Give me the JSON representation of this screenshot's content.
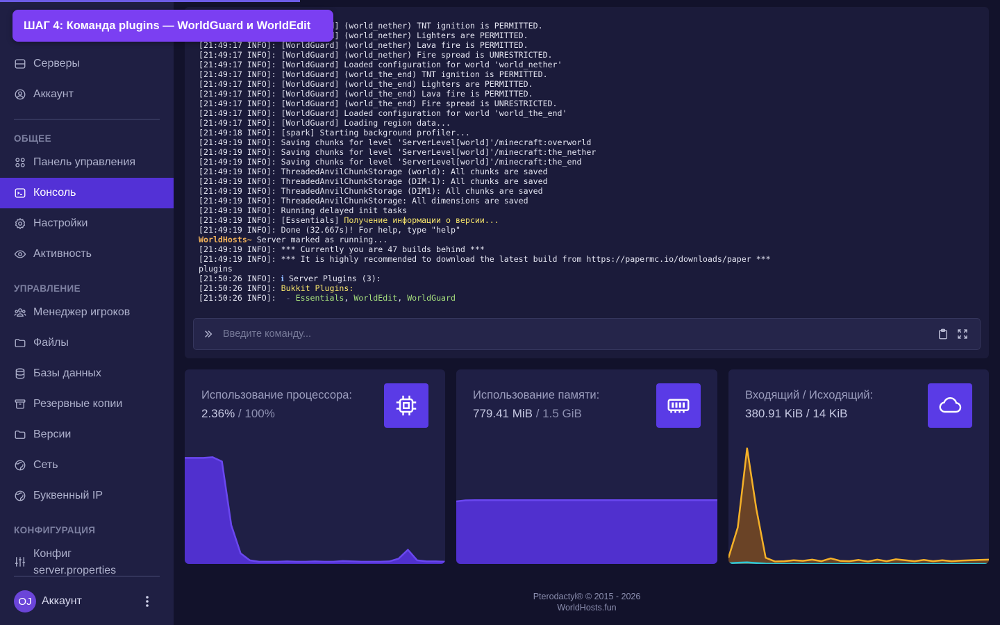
{
  "banner": {
    "text": "ШАГ 4: Команда plugins — WorldGuard и WorldEdit"
  },
  "sidebar": {
    "items_top": [
      {
        "label": "Серверы",
        "icon": "server-icon"
      },
      {
        "label": "Аккаунт",
        "icon": "user-circle-icon"
      }
    ],
    "section_general": "ОБЩЕЕ",
    "items_general": [
      {
        "label": "Панель управления",
        "icon": "dashboard-icon"
      },
      {
        "label": "Консоль",
        "icon": "terminal-icon",
        "active": true
      },
      {
        "label": "Настройки",
        "icon": "gear-icon"
      },
      {
        "label": "Активность",
        "icon": "eye-icon"
      }
    ],
    "section_manage": "УПРАВЛЕНИЕ",
    "items_manage": [
      {
        "label": "Менеджер игроков",
        "icon": "users-icon"
      },
      {
        "label": "Файлы",
        "icon": "folder-icon"
      },
      {
        "label": "Базы данных",
        "icon": "database-icon"
      },
      {
        "label": "Резервные копии",
        "icon": "archive-icon"
      },
      {
        "label": "Версии",
        "icon": "folder-icon"
      },
      {
        "label": "Сеть",
        "icon": "globe-icon"
      },
      {
        "label": "Буквенный IP",
        "icon": "globe-icon"
      }
    ],
    "section_config": "КОНФИГУРАЦИЯ",
    "config_item": {
      "line1": "Конфиг",
      "line2": "server.properties",
      "icon": "sliders-icon"
    },
    "user": {
      "initials": "OJ",
      "label": "Аккаунт"
    }
  },
  "console": {
    "lines": [
      [
        {
          "t": "[21:49:17 INFO]: [WorldGuard] (world_nether) TNT ignition is PERMITTED."
        }
      ],
      [
        {
          "t": "[21:49:17 INFO]: [WorldGuard] (world_nether) Lighters are PERMITTED."
        }
      ],
      [
        {
          "t": "[21:49:17 INFO]: [WorldGuard] (world_nether) Lava fire is PERMITTED."
        }
      ],
      [
        {
          "t": "[21:49:17 INFO]: [WorldGuard] (world_nether) Fire spread is UNRESTRICTED."
        }
      ],
      [
        {
          "t": "[21:49:17 INFO]: [WorldGuard] Loaded configuration for world 'world_nether'"
        }
      ],
      [
        {
          "t": "[21:49:17 INFO]: [WorldGuard] (world_the_end) TNT ignition is PERMITTED."
        }
      ],
      [
        {
          "t": "[21:49:17 INFO]: [WorldGuard] (world_the_end) Lighters are PERMITTED."
        }
      ],
      [
        {
          "t": "[21:49:17 INFO]: [WorldGuard] (world_the_end) Lava fire is PERMITTED."
        }
      ],
      [
        {
          "t": "[21:49:17 INFO]: [WorldGuard] (world_the_end) Fire spread is UNRESTRICTED."
        }
      ],
      [
        {
          "t": "[21:49:17 INFO]: [WorldGuard] Loaded configuration for world 'world_the_end'"
        }
      ],
      [
        {
          "t": "[21:49:17 INFO]: [WorldGuard] Loading region data..."
        }
      ],
      [
        {
          "t": "[21:49:18 INFO]: [spark] Starting background profiler..."
        }
      ],
      [
        {
          "t": "[21:49:19 INFO]: Saving chunks for level 'ServerLevel[world]'/minecraft:overworld"
        }
      ],
      [
        {
          "t": "[21:49:19 INFO]: Saving chunks for level 'ServerLevel[world]'/minecraft:the_nether"
        }
      ],
      [
        {
          "t": "[21:49:19 INFO]: Saving chunks for level 'ServerLevel[world]'/minecraft:the_end"
        }
      ],
      [
        {
          "t": "[21:49:19 INFO]: ThreadedAnvilChunkStorage (world): All chunks are saved"
        }
      ],
      [
        {
          "t": "[21:49:19 INFO]: ThreadedAnvilChunkStorage (DIM-1): All chunks are saved"
        }
      ],
      [
        {
          "t": "[21:49:19 INFO]: ThreadedAnvilChunkStorage (DIM1): All chunks are saved"
        }
      ],
      [
        {
          "t": "[21:49:19 INFO]: ThreadedAnvilChunkStorage: All dimensions are saved"
        }
      ],
      [
        {
          "t": "[21:49:19 INFO]: Running delayed init tasks"
        }
      ],
      [
        {
          "t": "[21:49:19 INFO]: [Essentials] "
        },
        {
          "t": "Получение информации о версии...",
          "c": "c-yellow"
        }
      ],
      [
        {
          "t": "[21:49:19 INFO]: Done (32.667s)! For help, type \"help\""
        }
      ],
      [
        {
          "t": "WorldHosts~",
          "c": "c-orange"
        },
        {
          "t": " Server marked as running..."
        }
      ],
      [
        {
          "t": "[21:49:19 INFO]: *** Currently you are 47 builds behind ***"
        }
      ],
      [
        {
          "t": "[21:49:19 INFO]: *** It is highly recommended to download the latest build from https://papermc.io/downloads/paper ***"
        }
      ],
      [
        {
          "t": "plugins"
        }
      ],
      [
        {
          "t": "[21:50:26 INFO]: "
        },
        {
          "t": "ℹ",
          "c": "c-blue"
        },
        {
          "t": " Server Plugins (3):"
        }
      ],
      [
        {
          "t": "[21:50:26 INFO]: "
        },
        {
          "t": "Bukkit Plugins:",
          "c": "c-yellow"
        }
      ],
      [
        {
          "t": "[21:50:26 INFO]:  "
        },
        {
          "t": "- ",
          "c": "c-gray"
        },
        {
          "t": "Essentials",
          "c": "c-green"
        },
        {
          "t": ", "
        },
        {
          "t": "WorldEdit",
          "c": "c-green"
        },
        {
          "t": ", "
        },
        {
          "t": "WorldGuard",
          "c": "c-green"
        }
      ]
    ],
    "placeholder": "Введите команду..."
  },
  "stats": {
    "cpu": {
      "label": "Использование процессора:",
      "value": "2.36%",
      "limit": "100%"
    },
    "memory": {
      "label": "Использование памяти:",
      "value": "779.41 MiB",
      "limit": "1.5 GiB"
    },
    "network": {
      "label": "Входящий / Исходящий:",
      "value": "380.91 KiB / 14 KiB"
    }
  },
  "chart_data": [
    {
      "type": "area",
      "title": "Использование процессора:",
      "ylim": [
        0,
        3.5
      ],
      "series": [
        {
          "values": [
            3.0,
            3.0,
            3.0,
            3.02,
            2.9,
            1.1,
            0.3,
            0.1,
            0.06,
            0.06,
            0.06,
            0.07,
            0.06,
            0.06,
            0.07,
            0.06,
            0.06,
            0.08,
            0.07,
            0.06,
            0.06,
            0.06,
            0.07,
            0.15,
            0.4,
            0.1,
            0.07,
            0.07,
            0.06
          ]
        }
      ],
      "colors": [
        "#5331d6"
      ]
    },
    {
      "type": "area",
      "title": "Использование памяти:",
      "ylim": [
        0,
        1536
      ],
      "series": [
        {
          "values": [
            777,
            790,
            791,
            791,
            791,
            791,
            791,
            791,
            791,
            791,
            791,
            791,
            791,
            791,
            791,
            791,
            791,
            791,
            791,
            791,
            791,
            791,
            791,
            791,
            791,
            791,
            791,
            791,
            792
          ]
        }
      ],
      "colors": [
        "#5331d6"
      ]
    },
    {
      "type": "area",
      "title": "Входящий / Исходящий:",
      "series": [
        {
          "values": [
            20,
            120,
            380,
            180,
            20,
            8,
            9,
            12,
            10,
            14,
            9,
            18,
            10,
            9,
            13,
            8,
            14,
            9,
            15,
            12,
            9,
            13,
            9,
            12,
            9,
            11,
            12,
            13,
            14
          ]
        },
        {
          "values": [
            2,
            4,
            5,
            3,
            1,
            0,
            0,
            0,
            0,
            0,
            0,
            0,
            0,
            0,
            0,
            0,
            0,
            0,
            0,
            0,
            0,
            0,
            0,
            0,
            0,
            0,
            0,
            0,
            0
          ]
        }
      ],
      "colors": [
        "#f5b128",
        "#2fc6d6"
      ]
    }
  ],
  "footer": {
    "line1": "Pterodactyl® © 2015 - 2026",
    "line2": "WorldHosts.fun"
  }
}
